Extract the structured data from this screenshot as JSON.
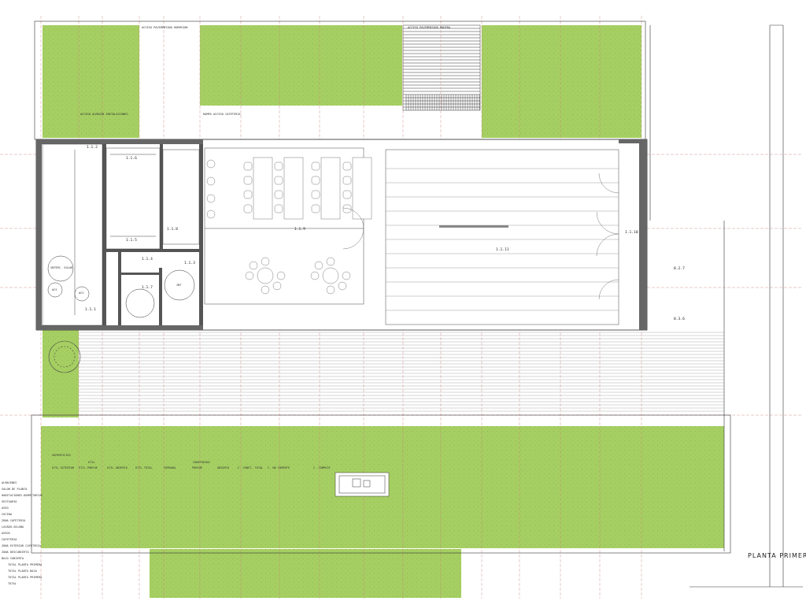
{
  "drawing": {
    "title": "PLANTA PRIMERA COTA",
    "zones": {
      "access_north": "ACCESO PAVIMENTADO HORMIGON",
      "access_wood": "ACCESO PAVIMENTADO MADERA",
      "access_west": "ACCESO ALMACEN INSTALACIONES",
      "access_center": "RAMPA ACCESO CAFETERIA"
    },
    "room_codes": [
      "1.1.2",
      "1.1.6",
      "1.1.5",
      "1.1.4",
      "1.1.3",
      "1.1.7",
      "1.1.8",
      "1.1.9",
      "1.1.11",
      "1.1.10",
      "1.1.1",
      "0.2.7",
      "0.3.6"
    ],
    "equipment": {
      "tank": "INTERC. SOLAR",
      "tank_2": "ACS",
      "tank_3": "ACS",
      "tank_4": "INT"
    },
    "table_headers": [
      "SUPERFICIES",
      "UTIL",
      "UTIL EXTERIOR",
      "UTIL PORCHE",
      "UTIL ABIERTA",
      "UTIL TOTAL",
      "CONSTRUIDA",
      "CERRADA",
      "PORCHE",
      "ABIERTA",
      "C. CONST. TOTAL",
      "C. NO COMPUTE",
      "C. COMPUTE"
    ],
    "table_rows": [
      "ALMACENES",
      "SALON DE PLANTA",
      "HABITACIONES-DORMITORIOS",
      "VESTUARIO",
      "ASEO",
      "COCINA",
      "ZONA CAFETERIA",
      "LAVADO-SOLANA",
      "ASEOS",
      "CAFETERIA",
      "ZONA EXTERIOR CAFETERIA",
      "ZONA DESCUBIERTA",
      "BAJO CUBIERTA",
      "TOTAL PLANTA PRIMERA",
      "TOTAL PLANTA BAJA",
      "TOTAL PLANTA PRIMERA",
      "TOTAL"
    ]
  }
}
